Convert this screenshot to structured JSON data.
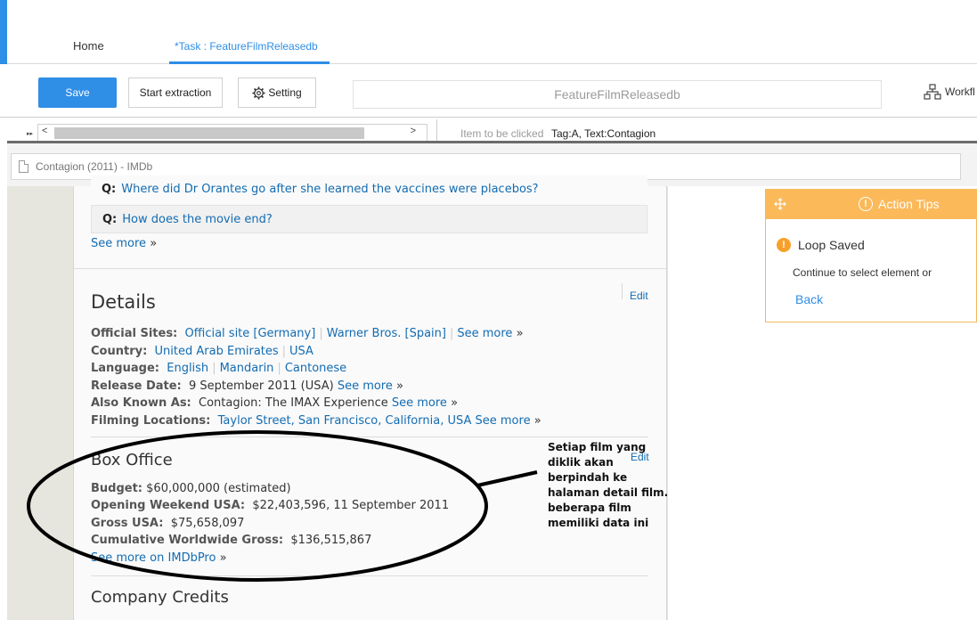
{
  "nav": {
    "home": "Home",
    "task_tab": "*Task : FeatureFilmReleasedb"
  },
  "toolbar": {
    "save": "Save",
    "start_extraction": "Start extraction",
    "setting": "Setting",
    "task_name": "FeatureFilmReleasedb",
    "workflow": "Workfl"
  },
  "clicked": {
    "label": "Item to be clicked",
    "value": "Tag:A, Text:Contagion"
  },
  "browser": {
    "tab_title": "Contagion (2011) - IMDb"
  },
  "faq": {
    "q_prefix": "Q:",
    "q1": "Where did Dr Orantes go after she learned the vaccines were placebos?",
    "q2": "How does the movie end?",
    "see_more": "See more",
    "raquo": "»"
  },
  "details": {
    "heading": "Details",
    "edit": "Edit",
    "official_sites_label": "Official Sites:",
    "official_sites": [
      "Official site [Germany]",
      "Warner Bros. [Spain]"
    ],
    "country_label": "Country:",
    "countries": [
      "United Arab Emirates",
      "USA"
    ],
    "language_label": "Language:",
    "languages": [
      "English",
      "Mandarin",
      "Cantonese"
    ],
    "release_label": "Release Date:",
    "release_value": "9 September 2011 (USA)",
    "aka_label": "Also Known As:",
    "aka_value": "Contagion: The IMAX Experience",
    "filming_label": "Filming Locations:",
    "filming_value": "Taylor Street, San Francisco, California, USA",
    "see_more": "See more",
    "raquo": "»"
  },
  "box_office": {
    "heading": "Box Office",
    "edit": "Edit",
    "budget_label": "Budget:",
    "budget_value": "$60,000,000 (estimated)",
    "opening_label": "Opening Weekend USA:",
    "opening_value": "$22,403,596, 11 September 2011",
    "gross_label": "Gross USA:",
    "gross_value": "$75,658,097",
    "cumulative_label": "Cumulative Worldwide Gross:",
    "cumulative_value": "$136,515,867",
    "imdbpro": "See more on IMDbPro",
    "raquo": "»"
  },
  "company": {
    "heading": "Company Credits"
  },
  "annotation": {
    "note": "Setiap film yang diklik akan berpindah ke halaman detail film. beberapa film memiliki data ini"
  },
  "tips": {
    "title": "Action Tips",
    "status": "Loop Saved",
    "message": "Continue to select element or",
    "back": "Back",
    "colors": {
      "header": "#fbb95a",
      "warning": "#f7a12b",
      "accent": "#2f8ee6"
    }
  },
  "icons": {
    "setting": "gear-icon",
    "workflow": "workflow-icon",
    "tab": "document-icon",
    "tips_move": "move-icon",
    "tips_info": "exclamation-icon"
  }
}
